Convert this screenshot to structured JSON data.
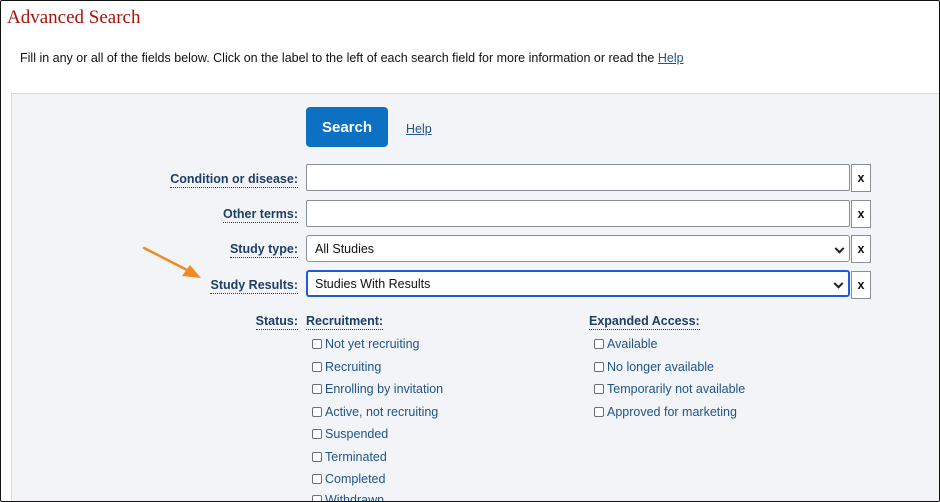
{
  "title": "Advanced Search",
  "intro": {
    "text": "Fill in any or all of the fields below. Click on the label to the left of each search field for more information or read the",
    "help_link": "Help"
  },
  "buttons": {
    "search": "Search",
    "help": "Help",
    "clear": "x"
  },
  "fields": {
    "condition": {
      "label": "Condition or disease:",
      "value": ""
    },
    "other_terms": {
      "label": "Other terms:",
      "value": ""
    },
    "study_type": {
      "label": "Study type:",
      "value": "All Studies"
    },
    "study_results": {
      "label": "Study Results:",
      "value": "Studies With Results"
    }
  },
  "status": {
    "label": "Status:",
    "recruitment": {
      "heading": "Recruitment:",
      "options": [
        "Not yet recruiting",
        "Recruiting",
        "Enrolling by invitation",
        "Active, not recruiting",
        "Suspended",
        "Terminated",
        "Completed",
        "Withdrawn"
      ]
    },
    "expanded_access": {
      "heading": "Expanded Access:",
      "options": [
        "Available",
        "No longer available",
        "Temporarily not available",
        "Approved for marketing"
      ]
    }
  },
  "colors": {
    "accent": "#0c71c3",
    "title": "#a5130f",
    "arrow": "#f08a24",
    "focus": "#1e5bd6"
  }
}
